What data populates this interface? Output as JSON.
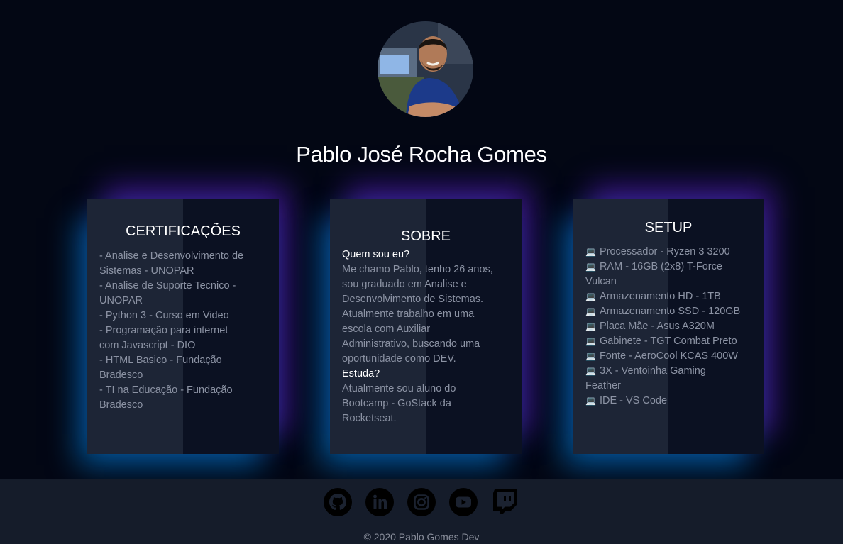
{
  "profile": {
    "name": "Pablo José Rocha Gomes"
  },
  "cards": {
    "certificacoes": {
      "title": "CERTIFICAÇÕES",
      "lines": [
        "- Analise e Desenvolvimento de",
        "Sistemas - UNOPAR",
        "- Analise de Suporte Tecnico -",
        "UNOPAR",
        "- Python 3 - Curso em Video",
        "- Programação para internet",
        "com Javascript - DIO",
        "- HTML Basico - Fundação",
        "Bradesco",
        "- TI na Educação - Fundação",
        "Bradesco"
      ]
    },
    "sobre": {
      "title": "SOBRE",
      "q1": "Quem sou eu?",
      "a1": [
        "Me chamo Pablo, tenho 26 anos,",
        "sou graduado em Analise e",
        "Desenvolvimento de Sistemas.",
        "Atualmente trabalho em uma",
        "escola com Auxiliar",
        "Administrativo, buscando uma",
        "oportunidade como DEV."
      ],
      "q2": "Estuda?",
      "a2": [
        "Atualmente sou aluno do",
        "Bootcamp - GoStack da",
        "Rocketseat."
      ]
    },
    "setup": {
      "title": "SETUP",
      "icon": "💻",
      "lines": [
        "Processador - Ryzen 3 3200",
        "RAM - 16GB (2x8) T-Force",
        "Vulcan",
        "Armazenamento HD - 1TB",
        "Armazenamento SSD - 120GB",
        "Placa Mãe - Asus A320M",
        "Gabinete - TGT Combat Preto",
        "Fonte - AeroCool KCAS 400W",
        "3X - Ventoinha Gaming",
        "Feather",
        "IDE - VS Code"
      ]
    }
  },
  "footer": {
    "copyright": "© 2020 Pablo Gomes Dev",
    "social_icons": [
      "github-icon",
      "linkedin-icon",
      "instagram-icon",
      "youtube-icon",
      "twitch-icon"
    ]
  },
  "colors": {
    "background": "#030714",
    "card_left": "#1d2536",
    "card_right": "#0b1122",
    "glow_blue": "#0096ff",
    "glow_purple": "#6e28f0",
    "footer": "#151c2a"
  }
}
